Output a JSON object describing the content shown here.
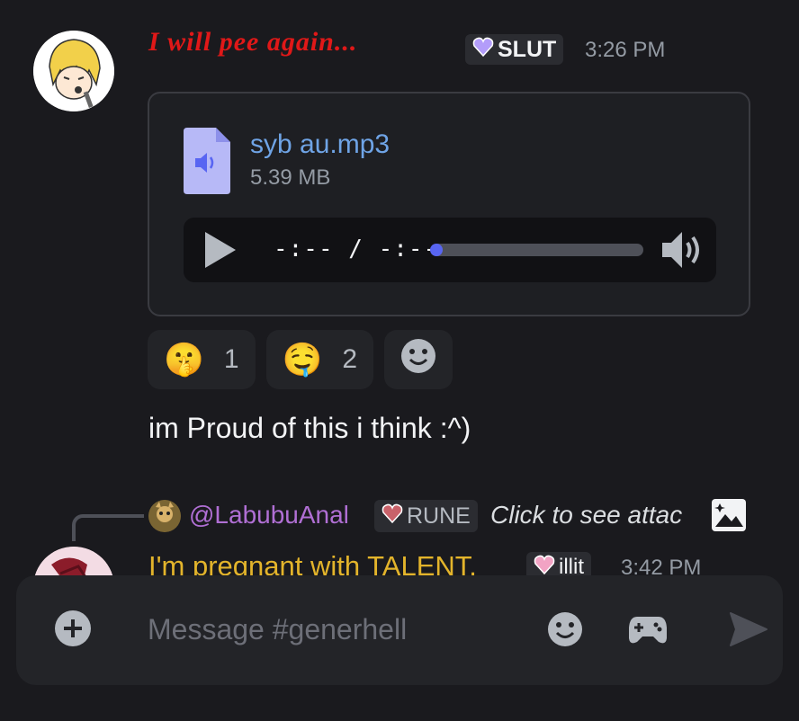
{
  "message1": {
    "username": "I will pee again...",
    "tag": {
      "icon": "heart-gem-icon",
      "label": "SLUT",
      "color": "#a78bfa"
    },
    "timestamp": "3:26 PM",
    "attachment": {
      "file_name": "syb au.mp3",
      "file_size": "5.39 MB",
      "time_display": "-:-- / -:--"
    },
    "reactions": [
      {
        "emoji": "🤫",
        "count": "1"
      },
      {
        "emoji": "🤤",
        "count": "2"
      }
    ],
    "text": "im Proud of this i think :^)"
  },
  "message2": {
    "reply": {
      "user": "@LabubuAnal",
      "tag": {
        "icon": "heart-gem-icon",
        "label": "RUNE"
      },
      "preview": "Click to see attac"
    },
    "username": "I'm pregnant with TALENT.",
    "tag": {
      "icon": "heart-gem-icon",
      "label": "illit"
    },
    "timestamp": "3:42 PM"
  },
  "composer": {
    "placeholder": "Message #generhell"
  },
  "colors": {
    "background": "#1a1a1e",
    "username1": "#e01818",
    "username2": "#e3b42b",
    "reply_user": "#b06fd4",
    "link": "#6fa4e6",
    "accent": "#5865f2"
  }
}
